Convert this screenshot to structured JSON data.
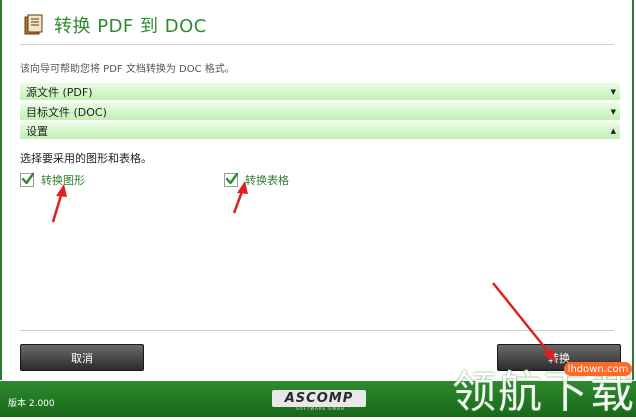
{
  "header": {
    "title": "转换 PDF 到 DOC",
    "icon": "document-stack-icon"
  },
  "description": "该向导可帮助您将 PDF 文档转换为 DOC 格式。",
  "sections": [
    {
      "label": "源文件 (PDF)",
      "state": "collapsed"
    },
    {
      "label": "目标文件 (DOC)",
      "state": "collapsed"
    },
    {
      "label": "设置",
      "state": "expanded"
    }
  ],
  "settings": {
    "prompt": "选择要采用的图形和表格。",
    "convert_graphics": {
      "label": "转换图形",
      "checked": true
    },
    "convert_tables": {
      "label": "转换表格",
      "checked": true
    }
  },
  "buttons": {
    "cancel": "取消",
    "convert": "转换"
  },
  "footer": {
    "version": "版本 2.000",
    "logo": "ASCOMP",
    "logo_sub": "SOFTWARE GMBH"
  },
  "watermark": {
    "url": "lhdown.com",
    "name": "领航下载"
  },
  "colors": {
    "accent": "#2e8b2e",
    "section_bg": "#c3f0b4",
    "footer": "#1f7a1f",
    "annotation_arrow": "#e02020"
  }
}
